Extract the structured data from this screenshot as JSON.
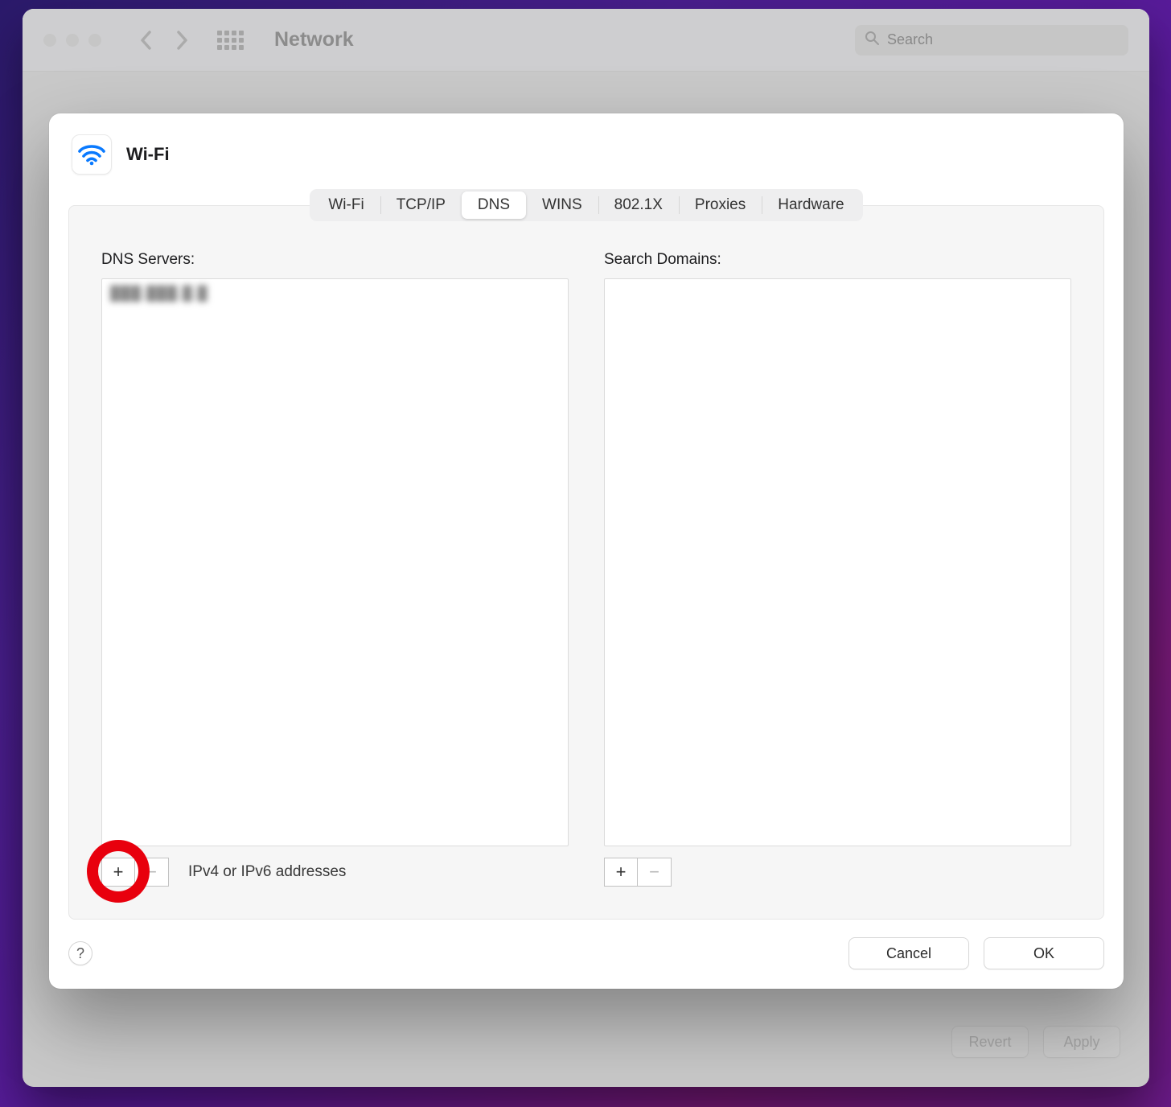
{
  "parent": {
    "title": "Network",
    "search_placeholder": "Search",
    "footer": {
      "revert": "Revert",
      "apply": "Apply"
    }
  },
  "sheet": {
    "title": "Wi-Fi",
    "tabs": [
      "Wi-Fi",
      "TCP/IP",
      "DNS",
      "WINS",
      "802.1X",
      "Proxies",
      "Hardware"
    ],
    "active_tab_index": 2,
    "dns": {
      "servers_label": "DNS Servers:",
      "servers_hint": "IPv4 or IPv6 addresses",
      "servers_entries": [
        "███.███.█.█"
      ]
    },
    "domains": {
      "label": "Search Domains:",
      "entries": []
    },
    "buttons": {
      "add": "+",
      "remove": "−"
    },
    "footer": {
      "help": "?",
      "cancel": "Cancel",
      "ok": "OK"
    }
  }
}
